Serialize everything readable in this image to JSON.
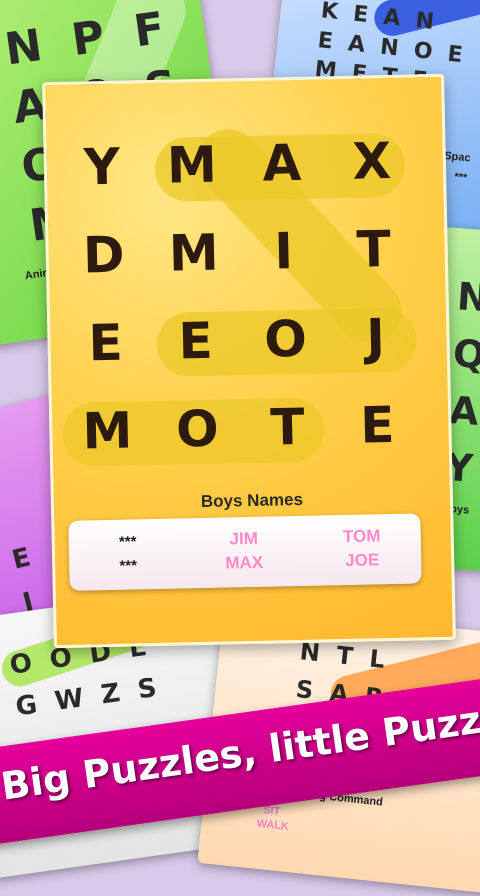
{
  "main_puzzle": {
    "rows": [
      [
        "Y",
        "M",
        "A",
        "X"
      ],
      [
        "D",
        "M",
        "I",
        "T"
      ],
      [
        "E",
        "E",
        "O",
        "J"
      ],
      [
        "M",
        "O",
        "T",
        "E"
      ]
    ],
    "category": "Boys Names",
    "words": [
      {
        "left": "***",
        "middle": "JIM",
        "right": "TOM"
      },
      {
        "left": "***",
        "middle": "MAX",
        "right": "JOE"
      }
    ]
  },
  "background_cards": {
    "top_left": {
      "letters": "N  P  F\nA  O  S\nO  E  I\nM  P  R",
      "label": "Anim"
    },
    "top_right": {
      "letters": "K  E  A  N\nE  A  N  O  E\nM  E  T  E\nS\nN  A",
      "label": "in Spac",
      "stars": "***"
    },
    "right": {
      "letters": "N\nQ\nA\nY",
      "label": "Boys"
    },
    "left": {
      "letters": "E\nI\nT  E\nO  O  D  L",
      "label": ""
    },
    "bottom_left": {
      "letters": "O  O  D  L\nG  W  Z  S",
      "label": ""
    },
    "bottom_right": {
      "letters": "N  T  L\nS  A  R  L\nP  T  I",
      "label": "Dog Command",
      "words": [
        "SIT",
        "WALK"
      ]
    }
  },
  "banner": {
    "text": "Big Puzzles, little Puzzles!"
  },
  "colors": {
    "main_card": "#ffd04a",
    "highlight": "#ebc828",
    "found_word": "#ff89c7",
    "banner": "#e5009a"
  }
}
